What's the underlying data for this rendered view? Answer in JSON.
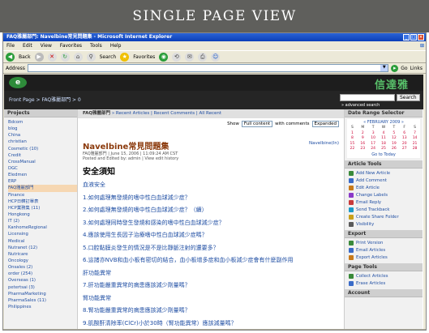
{
  "banner": "SINGLE PAGE VIEW",
  "window": {
    "title": "FAQ雅麗部門: Navelbine常見問題集 - Microsoft Internet Explorer"
  },
  "menu": [
    "File",
    "Edit",
    "View",
    "Favorites",
    "Tools",
    "Help"
  ],
  "toolbar": {
    "back": "Back",
    "search": "Search",
    "favorites": "Favorites"
  },
  "address": {
    "label": "Address",
    "go": "Go",
    "links": "Links"
  },
  "site": {
    "logo": "e",
    "brand": "信達雅",
    "breadcrumb": "Front Page > FAQ雅麗部門 > 0",
    "search_button": "Search",
    "advanced": "» advanced search"
  },
  "projects": {
    "title": "Projects",
    "items": [
      "Bdcom",
      "blog",
      "China",
      "christian",
      "Cosmetic (10)",
      "Credit",
      "CrossManual",
      "DGC",
      "Eledmen",
      "ERP",
      "FAQ雅麗部門",
      "Finance",
      "HCP日韓訂單表",
      "HCP業務集 (11)",
      "Hongkong",
      "IT (2)",
      "KanhomeRegional",
      "Licensing",
      "Medical",
      "Nutranet (12)",
      "Nutricare",
      "Oncology",
      "Onsales (2)",
      "order (254)",
      "Overseas (1)",
      "petertsai (3)",
      "PharmaMarketing",
      "PharmaSales (11)",
      "Philippines"
    ],
    "selected_index": 10
  },
  "main": {
    "header_title": "FAQ雅麗部門",
    "header_links": "» Recent Articles | Recent Comments | All Recent",
    "show_label": "Show",
    "show_value": "Full content",
    "comments_label": "with comments",
    "comments_value": "Expanded",
    "article_title": "Navelbine常見問題集",
    "article_tag": "Navelbine(In)",
    "meta1": "FAQ雅麗部門 | June 15, 2006 | 11:09:24 AM CST",
    "meta2": "Posted and Edited by: admin | View edit history",
    "subtitle": "安全須知",
    "lines": [
      "血液安全",
      "1.如何處理無發燒的嗜中性白血球減少症？",
      "2.如何處理無發燒的嗜中性白血球減少症？（續）",
      "3.如何處理同時發生發燒和感染的嗜中性白血球減少症？",
      "4.應該使用生長因子治療嗜中性白血球減少症嗎？",
      "5.口腔黏膜炎發生的情況是不是比靜脈注射的還要多？",
      "6.這諸亦NVB和血小板有密切的結合，血小板增多症和血小板減少症會有什麼副作用",
      "肝功能異常",
      "7.肝功能嚴重異常的病患應該減少劑量嗎？",
      "腎功能異常",
      "8.腎功能嚴重異常的病患應該減少劑量嗎？",
      "9.肌酸酐清除率(ClCr)小於30時（腎功能異常）應該減量嗎？"
    ]
  },
  "right": {
    "date_title": "Date Range Selector",
    "month": "« FEBRUARY 2009 »",
    "daynames": [
      "S",
      "M",
      "T",
      "W",
      "T",
      "F",
      "S"
    ],
    "days": [
      "1",
      "2",
      "3",
      "4",
      "5",
      "6",
      "7",
      "8",
      "9",
      "10",
      "11",
      "12",
      "13",
      "14",
      "15",
      "16",
      "17",
      "18",
      "19",
      "20",
      "21",
      "22",
      "23",
      "24",
      "25",
      "26",
      "27",
      "28"
    ],
    "goto": "Go to Today",
    "tools_title": "Article Tools",
    "tools": [
      "Add New Article",
      "Add Comment",
      "Edit Article",
      "Change Labels",
      "Email Reply",
      "Send Trackback",
      "Create Share Folder",
      "Visibility"
    ],
    "export_title": "Export",
    "export": [
      "Print Version",
      "Email Articles",
      "Export Articles"
    ],
    "pagetools_title": "Page Tools",
    "pagetools": [
      "Collect Articles",
      "Erase Articles"
    ],
    "account_title": "Account"
  }
}
